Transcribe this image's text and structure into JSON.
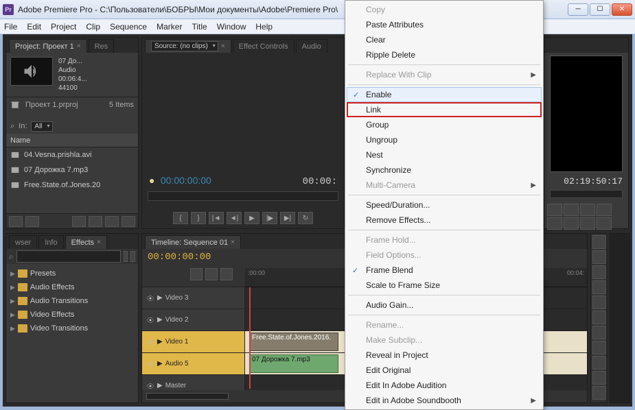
{
  "window": {
    "title": "Adobe Premiere Pro - C:\\Пользователи\\БОБРЫ\\Мои документы\\Adobe\\Premiere Pro\\",
    "app_abbrev": "Pr"
  },
  "menu": [
    "File",
    "Edit",
    "Project",
    "Clip",
    "Sequence",
    "Marker",
    "Title",
    "Window",
    "Help"
  ],
  "project": {
    "tab": "Project: Проект 1",
    "tab2": "Res",
    "clip_title": "07 До...",
    "clip_type": "Audio",
    "clip_duration": "00:06:4...",
    "clip_rate": "44100",
    "bin_name": "Проект 1.prproj",
    "item_count": "5 Items",
    "in_label": "In:",
    "in_value": "All",
    "name_col": "Name",
    "items": [
      "04.Vesna.prishla.avi",
      "07 Дорожка 7.mp3",
      "Free.State.of.Jones.20"
    ]
  },
  "source": {
    "tab": "Source: (no clips)",
    "tab_ec": "Effect Controls",
    "tab_am": "Audio",
    "tc_left": "00:00:00:00",
    "tc_right": "00:00:"
  },
  "program": {
    "tc": "02:19:50:17"
  },
  "effects": {
    "tabs": [
      "wser",
      "Info",
      "Effects"
    ],
    "search_placeholder": "",
    "items": [
      "Presets",
      "Audio Effects",
      "Audio Transitions",
      "Video Effects",
      "Video Transitions"
    ]
  },
  "timeline": {
    "tab": "Timeline: Sequence 01",
    "tc": "00:00:00:00",
    "ruler_tick": ":00:00",
    "ruler_t2": "00:04:",
    "tracks": [
      {
        "name": "Video 3",
        "sel": false
      },
      {
        "name": "Video 2",
        "sel": false
      },
      {
        "name": "Video 1",
        "sel": true,
        "clip": "Free.State.of.Jones.2016."
      },
      {
        "name": "Audio 5",
        "sel": true,
        "clip": "07 Дорожка 7.mp3",
        "audio": true
      },
      {
        "name": "Master",
        "sel": false
      }
    ]
  },
  "context_menu": [
    {
      "label": "Copy",
      "dis": true
    },
    {
      "label": "Paste Attributes"
    },
    {
      "label": "Clear"
    },
    {
      "label": "Ripple Delete"
    },
    {
      "sep": true
    },
    {
      "label": "Replace With Clip",
      "submenu": true,
      "dis": true
    },
    {
      "sep": true
    },
    {
      "label": "Enable",
      "checked": true,
      "hl": true
    },
    {
      "label": "Link",
      "boxed": true
    },
    {
      "label": "Group"
    },
    {
      "label": "Ungroup"
    },
    {
      "label": "Nest"
    },
    {
      "label": "Synchronize"
    },
    {
      "label": "Multi-Camera",
      "submenu": true,
      "dis": true
    },
    {
      "sep": true
    },
    {
      "label": "Speed/Duration..."
    },
    {
      "label": "Remove Effects..."
    },
    {
      "sep": true
    },
    {
      "label": "Frame Hold...",
      "dis": true
    },
    {
      "label": "Field Options...",
      "dis": true
    },
    {
      "label": "Frame Blend",
      "checked": true
    },
    {
      "label": "Scale to Frame Size"
    },
    {
      "sep": true
    },
    {
      "label": "Audio Gain..."
    },
    {
      "sep": true
    },
    {
      "label": "Rename...",
      "dis": true
    },
    {
      "label": "Make Subclip...",
      "dis": true
    },
    {
      "label": "Reveal in Project"
    },
    {
      "label": "Edit Original"
    },
    {
      "label": "Edit In Adobe Audition"
    },
    {
      "label": "Edit in Adobe Soundbooth",
      "submenu": true
    }
  ]
}
